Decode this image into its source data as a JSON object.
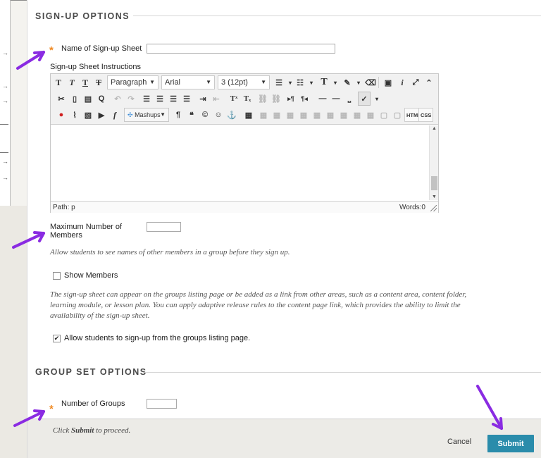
{
  "sections": {
    "signup_options_title": "SIGN-UP OPTIONS",
    "group_set_options_title": "GROUP SET OPTIONS"
  },
  "fields": {
    "required_marker": "*",
    "signup_sheet_name": {
      "label": "Name of Sign-up Sheet",
      "value": ""
    },
    "signup_instructions_label": "Sign-up Sheet Instructions",
    "max_members": {
      "label_line1": "Maximum Number of",
      "label_line2": "Members",
      "value": ""
    },
    "max_members_help": "Allow students to see names of other members in a group before they sign up.",
    "show_members": {
      "label": "Show Members",
      "checked": false
    },
    "signup_sheet_help_line1": "The sign-up sheet can appear on the groups listing page or be added as a link from other areas, such as a content area, content folder,",
    "signup_sheet_help_line2": "learning module, or lesson plan. You can apply adaptive release rules to the content page link, which provides the ability to limit the",
    "signup_sheet_help_line3": "availability of the sign-up sheet.",
    "allow_from_listing": {
      "label": "Allow students to sign-up from the groups listing page.",
      "checked": true
    },
    "number_of_groups": {
      "label": "Number of Groups",
      "value": ""
    }
  },
  "editor": {
    "paragraph": "Paragraph",
    "font": "Arial",
    "size": "3 (12pt)",
    "mashups": "Mashups",
    "html_btn": "HTML",
    "css_btn": "CSS",
    "path_label": "Path: p",
    "words_label": "Words:0"
  },
  "footer": {
    "prompt_pre": "Click ",
    "prompt_bold": "Submit",
    "prompt_post": " to proceed.",
    "cancel": "Cancel",
    "submit": "Submit"
  },
  "colors": {
    "required": "#f08a24",
    "submit_bg": "#2a8cab",
    "annotation_arrow": "#8a2be2"
  }
}
